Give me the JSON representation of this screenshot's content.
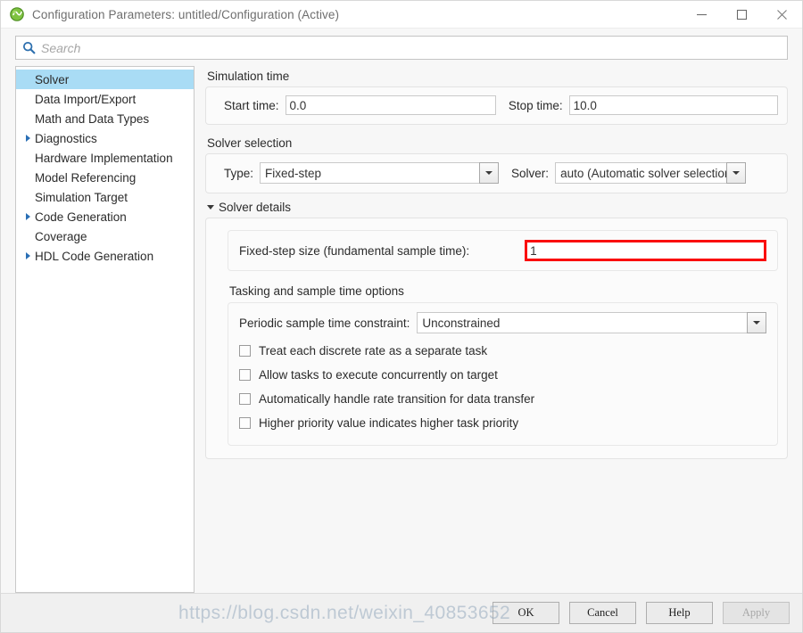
{
  "window": {
    "title": "Configuration Parameters: untitled/Configuration (Active)",
    "app_icon": "simulink-icon",
    "minimize_label": "—",
    "maximize_label": "□",
    "close_label": "×"
  },
  "search": {
    "placeholder": "Search",
    "value": "",
    "icon": "search-icon"
  },
  "sidebar": {
    "items": [
      {
        "label": "Solver",
        "expandable": false,
        "selected": true
      },
      {
        "label": "Data Import/Export",
        "expandable": false,
        "selected": false
      },
      {
        "label": "Math and Data Types",
        "expandable": false,
        "selected": false
      },
      {
        "label": "Diagnostics",
        "expandable": true,
        "selected": false
      },
      {
        "label": "Hardware Implementation",
        "expandable": false,
        "selected": false
      },
      {
        "label": "Model Referencing",
        "expandable": false,
        "selected": false
      },
      {
        "label": "Simulation Target",
        "expandable": false,
        "selected": false
      },
      {
        "label": "Code Generation",
        "expandable": true,
        "selected": false
      },
      {
        "label": "Coverage",
        "expandable": false,
        "selected": false
      },
      {
        "label": "HDL Code Generation",
        "expandable": true,
        "selected": false
      }
    ]
  },
  "simulation_time": {
    "title": "Simulation time",
    "start_label": "Start time:",
    "start_value": "0.0",
    "stop_label": "Stop time:",
    "stop_value": "10.0"
  },
  "solver_selection": {
    "title": "Solver selection",
    "type_label": "Type:",
    "type_value": "Fixed-step",
    "solver_label": "Solver:",
    "solver_value": "auto (Automatic solver selection)"
  },
  "solver_details": {
    "title": "Solver details",
    "expanded": true,
    "fixed_step_label": "Fixed-step size (fundamental sample time):",
    "fixed_step_value": "1",
    "highlight_color": "#fa0d0d"
  },
  "tasking": {
    "title": "Tasking and sample time options",
    "constraint_label": "Periodic sample time constraint:",
    "constraint_value": "Unconstrained",
    "checkboxes": [
      {
        "label": "Treat each discrete rate as a separate task",
        "checked": false
      },
      {
        "label": "Allow tasks to execute concurrently on target",
        "checked": false
      },
      {
        "label": "Automatically handle rate transition for data transfer",
        "checked": false
      },
      {
        "label": "Higher priority value indicates higher task priority",
        "checked": false
      }
    ]
  },
  "footer": {
    "ok_label": "OK",
    "cancel_label": "Cancel",
    "help_label": "Help",
    "apply_label": "Apply",
    "apply_disabled": true
  },
  "watermark": {
    "text": "https://blog.csdn.net/weixin_40853652"
  }
}
